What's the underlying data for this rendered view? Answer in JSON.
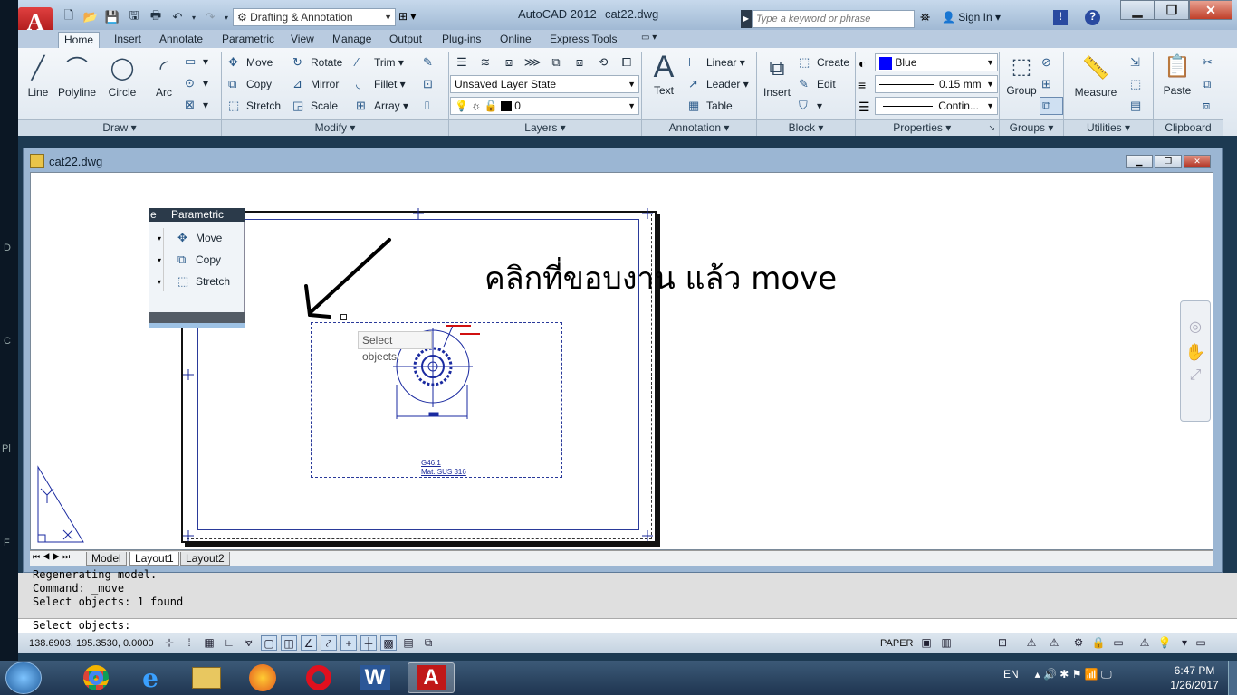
{
  "app": {
    "title": "AutoCAD 2012",
    "document": "cat22.dwg",
    "logo": "A"
  },
  "workspace": {
    "value": "Drafting & Annotation"
  },
  "search": {
    "placeholder": "Type a keyword or phrase"
  },
  "account": {
    "signin": "Sign In"
  },
  "ribbon_tabs": [
    "Home",
    "Insert",
    "Annotate",
    "Parametric",
    "View",
    "Manage",
    "Output",
    "Plug-ins",
    "Online",
    "Express Tools"
  ],
  "draw": {
    "title": "Draw",
    "line": "Line",
    "polyline": "Polyline",
    "circle": "Circle",
    "arc": "Arc"
  },
  "modify": {
    "title": "Modify",
    "move": "Move",
    "rotate": "Rotate",
    "trim": "Trim",
    "copy": "Copy",
    "mirror": "Mirror",
    "fillet": "Fillet",
    "stretch": "Stretch",
    "scale": "Scale",
    "array": "Array"
  },
  "layers": {
    "title": "Layers",
    "layer_state": "Unsaved Layer State",
    "current_layer": "0"
  },
  "annotation": {
    "title": "Annotation",
    "text": "Text",
    "linear": "Linear",
    "leader": "Leader",
    "table": "Table"
  },
  "block": {
    "title": "Block",
    "insert": "Insert",
    "create": "Create",
    "edit": "Edit"
  },
  "properties": {
    "title": "Properties",
    "color": "Blue",
    "color_hex": "#0000ff",
    "lineweight": "0.15 mm",
    "linetype": "Contin..."
  },
  "groups": {
    "title": "Groups",
    "group": "Group"
  },
  "utilities": {
    "title": "Utilities",
    "measure": "Measure"
  },
  "clipboard": {
    "title": "Clipboard",
    "paste": "Paste"
  },
  "floating_panel": {
    "header": "Parametric",
    "header_prefix": "e",
    "move": "Move",
    "copy": "Copy",
    "stretch": "Stretch"
  },
  "drawing": {
    "annotation": "คลิกที่ขอบงาน   แล้ว   move",
    "tooltip": "Select objects:",
    "part_no": "G46.1",
    "material": "Mat. SUS 316"
  },
  "layout_tabs": [
    "Model",
    "Layout1",
    "Layout2"
  ],
  "command": {
    "history": [
      "Regenerating model.",
      "Command: _move",
      "Select objects: 1 found"
    ],
    "prompt": "Select objects:"
  },
  "status": {
    "coords": "138.6903, 195.3530, 0.0000",
    "space": "PAPER"
  },
  "taskbar": {
    "lang": "EN",
    "time": "6:47 PM",
    "date": "1/26/2017"
  },
  "left_strip": [
    "D",
    "C",
    "Pl",
    "F"
  ]
}
